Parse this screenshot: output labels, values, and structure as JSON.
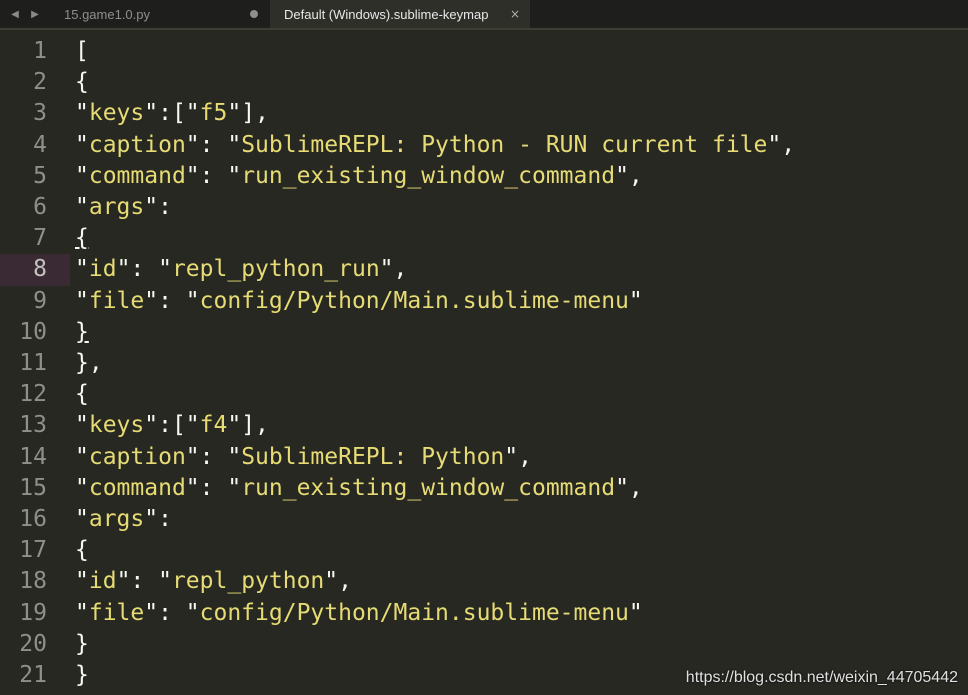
{
  "tabs": [
    {
      "label": "15.game1.0.py",
      "modified": true,
      "active": false
    },
    {
      "label": "Default (Windows).sublime-keymap",
      "close": "×",
      "active": true
    }
  ],
  "nav": {
    "left": "◀",
    "right": "▶"
  },
  "lines": [
    {
      "n": "1",
      "parts": [
        {
          "t": "[",
          "c": "p"
        }
      ]
    },
    {
      "n": "2",
      "parts": [
        {
          "t": "{",
          "c": "p"
        }
      ]
    },
    {
      "n": "3",
      "parts": [
        {
          "t": "\"",
          "c": "q"
        },
        {
          "t": "keys",
          "c": "s"
        },
        {
          "t": "\":[\"",
          "c": "q"
        },
        {
          "t": "f5",
          "c": "s"
        },
        {
          "t": "\"],",
          "c": "q"
        }
      ]
    },
    {
      "n": "4",
      "parts": [
        {
          "t": "\"",
          "c": "q"
        },
        {
          "t": "caption",
          "c": "s"
        },
        {
          "t": "\": \"",
          "c": "q"
        },
        {
          "t": "SublimeREPL: Python - RUN current file",
          "c": "s"
        },
        {
          "t": "\",",
          "c": "q"
        }
      ]
    },
    {
      "n": "5",
      "parts": [
        {
          "t": "\"",
          "c": "q"
        },
        {
          "t": "command",
          "c": "s"
        },
        {
          "t": "\": \"",
          "c": "q"
        },
        {
          "t": "run_existing_window_command",
          "c": "s"
        },
        {
          "t": "\",",
          "c": "q"
        }
      ]
    },
    {
      "n": "6",
      "parts": [
        {
          "t": "\"",
          "c": "q"
        },
        {
          "t": "args",
          "c": "s"
        },
        {
          "t": "\":",
          "c": "q"
        }
      ]
    },
    {
      "n": "7",
      "parts": [
        {
          "t": "{",
          "c": "p u"
        }
      ]
    },
    {
      "n": "8",
      "current": true,
      "parts": [
        {
          "t": "\"",
          "c": "q"
        },
        {
          "t": "id",
          "c": "s"
        },
        {
          "t": "\": \"",
          "c": "q"
        },
        {
          "t": "repl_python_run",
          "c": "s"
        },
        {
          "t": "\",",
          "c": "q"
        }
      ]
    },
    {
      "n": "9",
      "parts": [
        {
          "t": "\"",
          "c": "q"
        },
        {
          "t": "file",
          "c": "s"
        },
        {
          "t": "\": \"",
          "c": "q"
        },
        {
          "t": "config/Python/Main.sublime-menu",
          "c": "s"
        },
        {
          "t": "\"",
          "c": "q"
        }
      ]
    },
    {
      "n": "10",
      "parts": [
        {
          "t": "}",
          "c": "p u"
        }
      ]
    },
    {
      "n": "11",
      "parts": [
        {
          "t": "},",
          "c": "p"
        }
      ]
    },
    {
      "n": "12",
      "parts": [
        {
          "t": "{",
          "c": "p"
        }
      ]
    },
    {
      "n": "13",
      "parts": [
        {
          "t": "\"",
          "c": "q"
        },
        {
          "t": "keys",
          "c": "s"
        },
        {
          "t": "\":[\"",
          "c": "q"
        },
        {
          "t": "f4",
          "c": "s"
        },
        {
          "t": "\"],",
          "c": "q"
        }
      ]
    },
    {
      "n": "14",
      "parts": [
        {
          "t": "\"",
          "c": "q"
        },
        {
          "t": "caption",
          "c": "s"
        },
        {
          "t": "\": \"",
          "c": "q"
        },
        {
          "t": "SublimeREPL: Python",
          "c": "s"
        },
        {
          "t": "\",",
          "c": "q"
        }
      ]
    },
    {
      "n": "15",
      "parts": [
        {
          "t": "\"",
          "c": "q"
        },
        {
          "t": "command",
          "c": "s"
        },
        {
          "t": "\": \"",
          "c": "q"
        },
        {
          "t": "run_existing_window_command",
          "c": "s"
        },
        {
          "t": "\",",
          "c": "q"
        }
      ]
    },
    {
      "n": "16",
      "parts": [
        {
          "t": "\"",
          "c": "q"
        },
        {
          "t": "args",
          "c": "s"
        },
        {
          "t": "\":",
          "c": "q"
        }
      ]
    },
    {
      "n": "17",
      "parts": [
        {
          "t": "{",
          "c": "p"
        }
      ]
    },
    {
      "n": "18",
      "parts": [
        {
          "t": "\"",
          "c": "q"
        },
        {
          "t": "id",
          "c": "s"
        },
        {
          "t": "\": \"",
          "c": "q"
        },
        {
          "t": "repl_python",
          "c": "s"
        },
        {
          "t": "\",",
          "c": "q"
        }
      ]
    },
    {
      "n": "19",
      "parts": [
        {
          "t": "\"",
          "c": "q"
        },
        {
          "t": "file",
          "c": "s"
        },
        {
          "t": "\": \"",
          "c": "q"
        },
        {
          "t": "config/Python/Main.sublime-menu",
          "c": "s"
        },
        {
          "t": "\"",
          "c": "q"
        }
      ]
    },
    {
      "n": "20",
      "parts": [
        {
          "t": "}",
          "c": "p"
        }
      ]
    },
    {
      "n": "21",
      "parts": [
        {
          "t": "}",
          "c": "p"
        }
      ]
    }
  ],
  "watermark": "https://blog.csdn.net/weixin_44705442",
  "colors": {
    "background": "#272822",
    "string": "#e6db74",
    "punctuation": "#f8f8f2",
    "gutter": "#90908a",
    "current_line": "#3a2a33"
  }
}
